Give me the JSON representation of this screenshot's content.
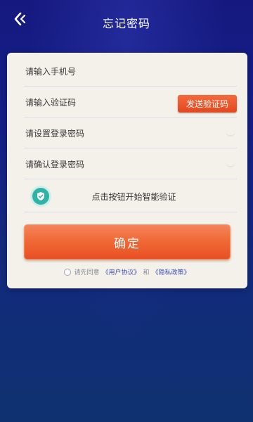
{
  "header": {
    "title": "忘记密码"
  },
  "form": {
    "phone_placeholder": "请输入手机号",
    "code_placeholder": "请输入验证码",
    "send_code_label": "发送验证码",
    "password_placeholder": "请设置登录密码",
    "confirm_password_placeholder": "请确认登录密码",
    "verify_label": "点击按钮开始智能验证",
    "confirm_label": "确定"
  },
  "agreement": {
    "prefix": "请先同意",
    "user_agreement": "《用户协议》",
    "and": "和",
    "privacy_policy": "《隐私政策》"
  },
  "colors": {
    "background": "#151c80",
    "card": "#f3f1ea",
    "accent": "#f06a37",
    "link": "#3f4fb5",
    "verify_icon": "#2fb3a6"
  }
}
